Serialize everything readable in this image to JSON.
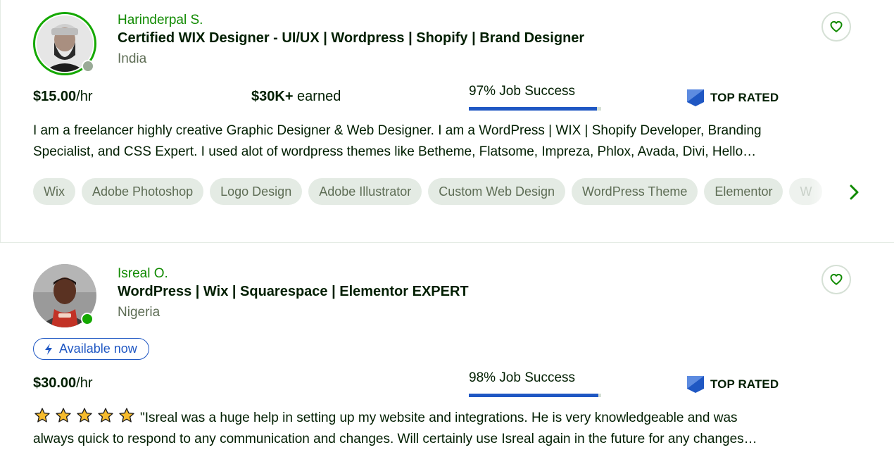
{
  "freelancers": [
    {
      "name": "Harinderpal S.",
      "title": "Certified WIX Designer - UI/UX | Wordpress | Shopify | Brand Designer",
      "country": "India",
      "online": false,
      "rate_amount": "$15.00",
      "rate_unit": "/hr",
      "earned_amount": "$30K+",
      "earned_suffix": " earned",
      "job_success_label": "97% Job Success",
      "job_success_pct": 97,
      "badge": "TOP RATED",
      "description_lines": [
        "I am a freelancer highly creative Graphic Designer & Web Designer. I am a WordPress | WIX | Shopify Developer, Branding",
        "Specialist, and CSS Expert. I used alot of wordpress themes like Betheme, Flatsome, Impreza, Phlox, Avada, Divi, Hello…"
      ],
      "skills": [
        "Wix",
        "Adobe Photoshop",
        "Logo Design",
        "Adobe Illustrator",
        "Custom Web Design",
        "WordPress Theme",
        "Elementor",
        "W"
      ]
    },
    {
      "name": "Isreal O.",
      "title": "WordPress | Wix | Squarespace | Elementor EXPERT",
      "country": "Nigeria",
      "online": true,
      "availability": "Available now",
      "rate_amount": "$30.00",
      "rate_unit": "/hr",
      "job_success_label": "98% Job Success",
      "job_success_pct": 98,
      "badge": "TOP RATED",
      "rating_stars": 5,
      "review_lines": [
        "\"Isreal was a huge help in setting up my website and integrations. He is very knowledgeable and was",
        "always quick to respond to any communication and changes. Will certainly use Isreal again in the future for any changes…"
      ]
    }
  ],
  "colors": {
    "brand_green": "#108a00",
    "online_green": "#14a800",
    "offline_gray": "#9aaa97",
    "progress_blue": "#1f57c3",
    "chip_bg": "#e4ebe4",
    "badge_blue": "#1f57c3"
  },
  "icons": {
    "favorite": "heart-outline-icon",
    "badge": "top-rated-badge-icon",
    "available": "lightning-icon",
    "next": "chevron-right-icon",
    "rating": "star-icon"
  }
}
